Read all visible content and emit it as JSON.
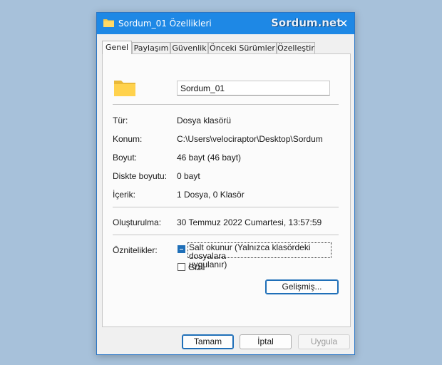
{
  "window": {
    "title": "Sordum_01 Özellikleri",
    "watermark": "Sordum.net",
    "close_glyph": "✕",
    "accent_color": "#1e88e5",
    "title_icon": "folder-icon"
  },
  "tabs": [
    {
      "label": "Genel",
      "active": true
    },
    {
      "label": "Paylaşım",
      "active": false
    },
    {
      "label": "Güvenlik",
      "active": false
    },
    {
      "label": "Önceki Sürümler",
      "active": false
    },
    {
      "label": "Özelleştir",
      "active": false
    }
  ],
  "general": {
    "folder_icon": "folder-icon",
    "name_value": "Sordum_01",
    "fields": [
      {
        "label": "Tür:",
        "value": "Dosya klasörü"
      },
      {
        "label": "Konum:",
        "value": "C:\\Users\\velociraptor\\Desktop\\Sordum"
      },
      {
        "label": "Boyut:",
        "value": "46 bayt (46 bayt)"
      },
      {
        "label": "Diskte boyutu:",
        "value": "0 bayt"
      },
      {
        "label": "İçerik:",
        "value": "1 Dosya, 0 Klasör"
      }
    ],
    "created": {
      "label": "Oluşturulma:",
      "value": "30 Temmuz 2022 Cumartesi, 13:57:59"
    },
    "attributes": {
      "label": "Öznitelikler:",
      "readonly": {
        "label_line1": "Salt okunur (Yalnızca klasördeki dosyalara",
        "label_line2": "uygulanır)",
        "state": "indeterminate"
      },
      "hidden": {
        "label": "Gizli",
        "checked": false
      },
      "advanced_button": "Gelişmiş..."
    }
  },
  "footer": {
    "ok": "Tamam",
    "cancel": "İptal",
    "apply": "Uygula"
  }
}
